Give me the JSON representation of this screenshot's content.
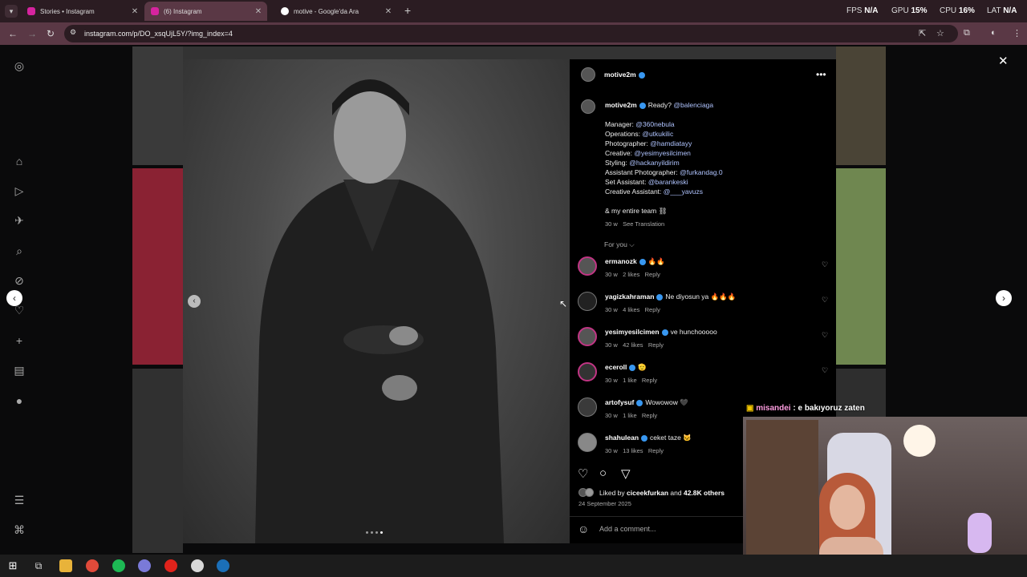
{
  "tabs": [
    {
      "title": "Stories • Instagram",
      "active": false
    },
    {
      "title": "(6) Instagram",
      "active": true
    },
    {
      "title": "motive - Google'da Ara",
      "active": false
    }
  ],
  "stats": {
    "fps_label": "FPS",
    "fps": "N/A",
    "gpu_label": "GPU",
    "gpu": "15",
    "cpu_label": "CPU",
    "cpu": "16",
    "lat_label": "LAT",
    "lat": "N/A"
  },
  "url": "instagram.com/p/DO_xsqUjL5Y/?img_index=4",
  "post": {
    "author": "motive2m",
    "caption": "Ready?",
    "caption_mention": "@balenciaga",
    "credits": [
      {
        "role": "Manager:",
        "handle": "@360nebula"
      },
      {
        "role": "Operations:",
        "handle": "@utkukilic"
      },
      {
        "role": "Photographer:",
        "handle": "@hamdiatayy"
      },
      {
        "role": "Creative:",
        "handle": "@yesimyesilcimen"
      },
      {
        "role": "Styling:",
        "handle": "@hackanyildirim"
      },
      {
        "role": "Assistant Photographer:",
        "handle": "@furkandag.0"
      },
      {
        "role": "Set Assistant:",
        "handle": "@barankeski"
      },
      {
        "role": "Creative Assistant:",
        "handle": "@___yavuzs"
      }
    ],
    "team": "& my entire team ⛓",
    "time": "30 w",
    "translate": "See Translation",
    "for_you": "For you",
    "comments": [
      {
        "user": "ermanozk",
        "text": "🔥🔥",
        "time": "30 w",
        "likes": "2 likes",
        "reply": "Reply"
      },
      {
        "user": "yagizkahraman",
        "text": "Ne diyosun ya 🔥🔥🔥",
        "time": "30 w",
        "likes": "4 likes",
        "reply": "Reply"
      },
      {
        "user": "yesimyesilcimen",
        "text": "ve hunchooooo",
        "time": "30 w",
        "likes": "42 likes",
        "reply": "Reply"
      },
      {
        "user": "eceroll",
        "text": "🫡",
        "time": "30 w",
        "likes": "1 like",
        "reply": "Reply"
      },
      {
        "user": "artofysuf",
        "text": "Wowowow 🖤",
        "time": "30 w",
        "likes": "1 like",
        "reply": "Reply"
      },
      {
        "user": "shahulean",
        "text": "ceket taze 🐱",
        "time": "30 w",
        "likes": "13 likes",
        "reply": "Reply"
      }
    ],
    "liked_prefix": "Liked by",
    "liked_user": "ciceekfurkan",
    "liked_and": "and",
    "liked_others": "42.8K others",
    "date": "24 September 2025",
    "add_comment": "Add a comment..."
  },
  "chat": {
    "user": "misandei",
    "text": ": e bakıyoruz zaten"
  }
}
